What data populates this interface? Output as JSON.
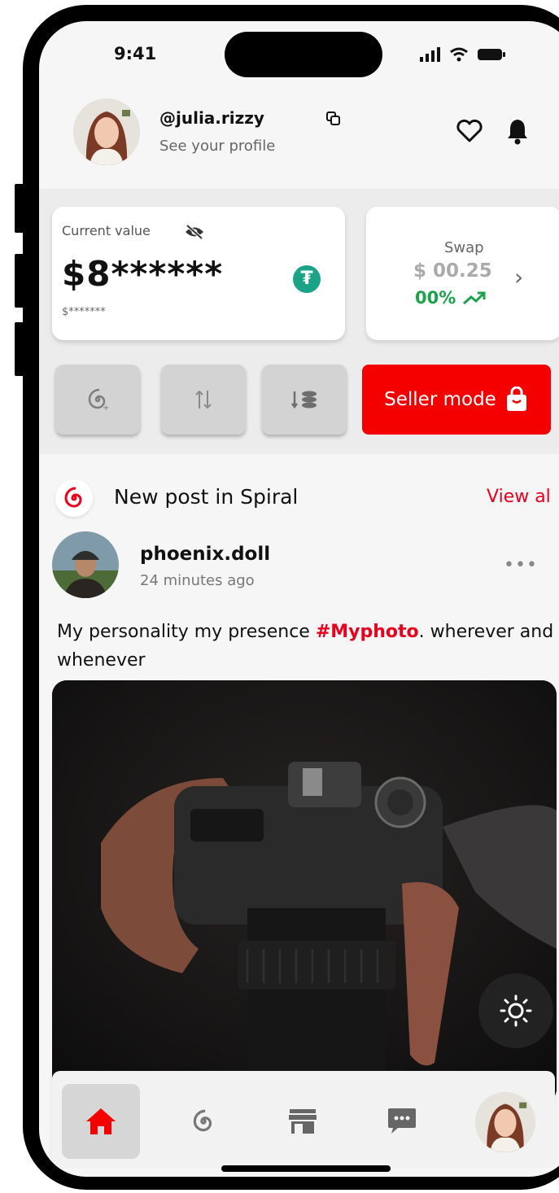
{
  "status_bar": {
    "time": "9:41"
  },
  "profile": {
    "username": "@julia.rizzy",
    "subtitle": "See your profile"
  },
  "wallet": {
    "current_value_label": "Current value",
    "amount_masked": "$8******",
    "sub_masked": "$*******",
    "swap_label": "Swap",
    "swap_amount": "$ 00.25",
    "swap_change": "00%"
  },
  "actions": {
    "seller_label": "Seller mode"
  },
  "feed": {
    "title": "New post in Spiral",
    "view_all": "View al",
    "post": {
      "author": "phoenix.doll",
      "time": "24 minutes ago",
      "text_before": "My personality my presence ",
      "hashtag": "#Myphoto",
      "text_after": ". wherever and whenever"
    }
  },
  "colors": {
    "accent": "#f50000",
    "tether": "#1aa386",
    "positive": "#1aa34a"
  },
  "icons": [
    "copy-icon",
    "heart-icon",
    "bell-icon",
    "eye-off-icon",
    "tether-icon",
    "spiral-add-icon",
    "swap-icon",
    "stack-coins-icon",
    "shopping-bag-icon",
    "spiral-icon",
    "more-dots-icon",
    "sun-icon",
    "home-icon",
    "store-icon",
    "chat-icon"
  ]
}
